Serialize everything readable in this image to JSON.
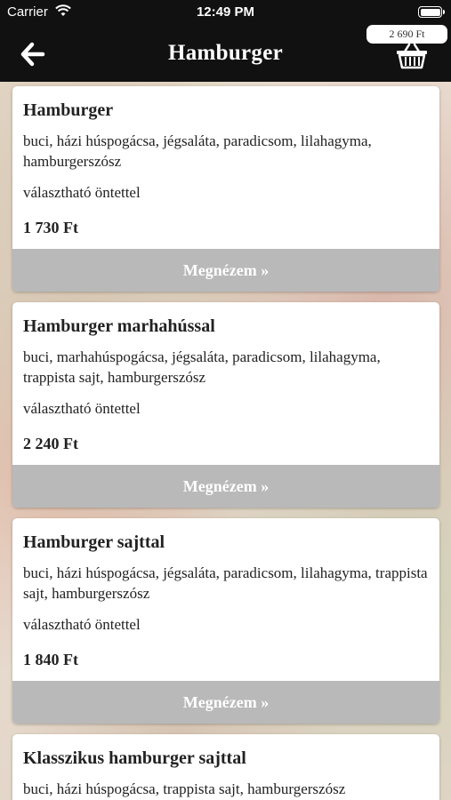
{
  "status_bar": {
    "carrier": "Carrier",
    "time": "12:49 PM"
  },
  "nav": {
    "title": "Hamburger",
    "cart_total": "2 690 Ft",
    "back_icon": "arrow-left-icon",
    "basket_icon": "basket-icon"
  },
  "products": [
    {
      "title": "Hamburger",
      "description": "buci, házi húspogácsa, jégsaláta, paradicsom, lilahagyma, hamburgerszósz",
      "option": "választható öntettel",
      "price": "1 730 Ft",
      "button": "Megnézem »"
    },
    {
      "title": "Hamburger marhahússal",
      "description": "buci, marhahúspogácsa, jégsaláta, paradicsom, lilahagyma, trappista sajt, hamburgerszósz",
      "option": "választható öntettel",
      "price": "2 240 Ft",
      "button": "Megnézem »"
    },
    {
      "title": "Hamburger sajttal",
      "description": "buci, házi húspogácsa, jégsaláta, paradicsom, lilahagyma, trappista sajt, hamburgerszósz",
      "option": "választható öntettel",
      "price": "1 840 Ft",
      "button": "Megnézem »"
    },
    {
      "title": "Klasszikus hamburger sajttal",
      "description": "buci, házi húspogácsa, trappista sajt, hamburgerszósz"
    }
  ],
  "colors": {
    "nav_background": "#111111",
    "button_background": "#b9b9b9",
    "card_background": "#ffffff"
  }
}
